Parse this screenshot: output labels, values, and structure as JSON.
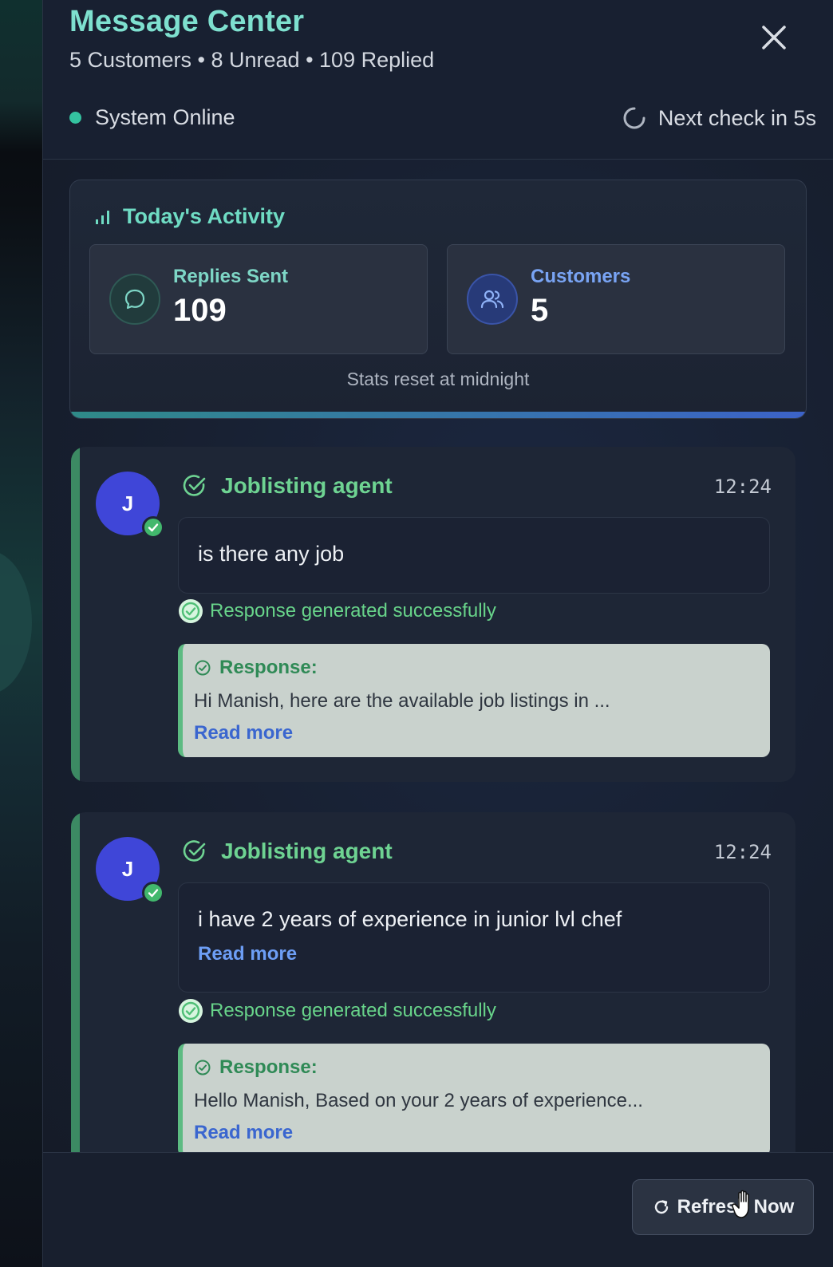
{
  "header": {
    "title": "Message Center",
    "subtitle": "5 Customers • 8 Unread • 109 Replied",
    "status_text": "System Online",
    "next_check": "Next check in 5s"
  },
  "activity": {
    "title": "Today's Activity",
    "stats": [
      {
        "label": "Replies Sent",
        "value": "109",
        "icon": "chat-bubble-icon"
      },
      {
        "label": "Customers",
        "value": "5",
        "icon": "users-icon"
      }
    ],
    "reset_note": "Stats reset at midnight"
  },
  "messages": [
    {
      "avatar_initial": "J",
      "sender": "Joblisting agent",
      "time": "12:24",
      "text": "is there any job",
      "read_more": "",
      "success": "Response generated successfully",
      "response_label": "Response:",
      "response_text": "Hi Manish, here are the available job listings in ...",
      "response_more": "Read more"
    },
    {
      "avatar_initial": "J",
      "sender": "Joblisting agent",
      "time": "12:24",
      "text": "i have 2 years of experience in junior lvl chef",
      "read_more": "Read more",
      "success": "Response generated successfully",
      "response_label": "Response:",
      "response_text": "Hello Manish, Based on your 2 years of experience...",
      "response_more": "Read more"
    }
  ],
  "footer": {
    "refresh_label": "Refresh Now"
  },
  "colors": {
    "accent_teal": "#7ee0cf",
    "success_green": "#68d48a",
    "link_blue": "#6d9ef5",
    "avatar_indigo": "#3f46d8"
  }
}
